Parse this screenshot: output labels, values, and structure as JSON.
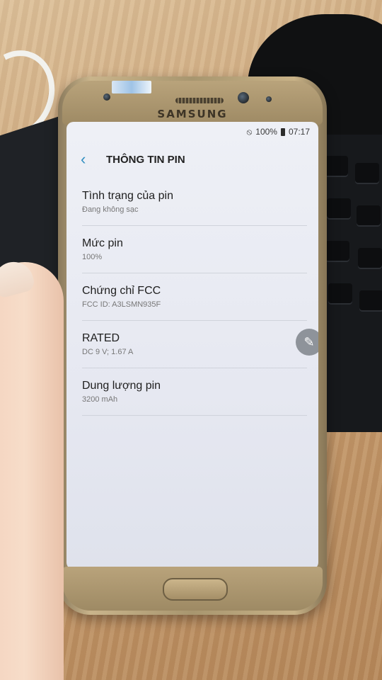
{
  "device": {
    "brand": "SAMSUNG"
  },
  "status_bar": {
    "mute_icon": "do-not-disturb-icon",
    "battery_percent": "100%",
    "battery_icon": "battery-icon",
    "time": "07:17"
  },
  "header": {
    "back_icon": "chevron-left-icon",
    "title": "THÔNG TIN PIN"
  },
  "items": [
    {
      "label": "Tình trạng của pin",
      "sub": "Đang không sạc"
    },
    {
      "label": "Mức pin",
      "sub": "100%"
    },
    {
      "label": "Chứng chỉ FCC",
      "sub": "FCC ID: A3LSMN935F"
    },
    {
      "label": "RATED",
      "sub": "DC 9 V; 1.67 A"
    },
    {
      "label": "Dung lượng pin",
      "sub": "3200 mAh"
    }
  ],
  "floating_button": {
    "icon": "pen-icon"
  }
}
